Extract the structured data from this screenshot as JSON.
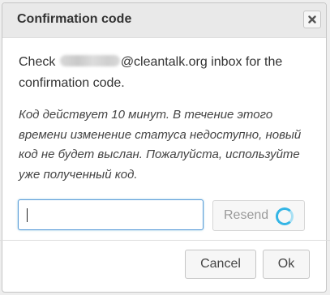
{
  "dialog": {
    "title": "Confirmation code",
    "close_icon": "close-icon",
    "message_prefix": "Check",
    "message_suffix": "@cleantalk.org inbox for the confirmation code.",
    "note": "Код действует 10 минут. В течение этого времени изменение статуса недоступно, новый код не будет выслан. Пожалуйста, используйте уже полученный код.",
    "code_input": {
      "value": "",
      "placeholder": ""
    },
    "resend_label": "Resend",
    "spinner_icon": "loading-spinner-icon",
    "cancel_label": "Cancel",
    "ok_label": "Ok"
  },
  "colors": {
    "accent": "#5b9dd9",
    "spinner": "#33b5e5"
  }
}
